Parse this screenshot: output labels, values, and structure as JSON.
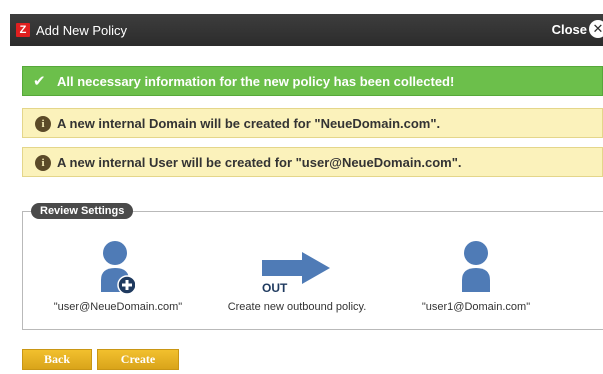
{
  "window": {
    "app_icon_glyph": "Z",
    "title": "Add New Policy",
    "close_label": "Close",
    "close_icon_glyph": "✕"
  },
  "banners": {
    "success": {
      "icon": "check-icon",
      "text": "All necessary information for the new policy has been collected!",
      "color": "#6cbf4b"
    },
    "domain_info": {
      "icon": "info-icon",
      "icon_glyph": "i",
      "text": "A new internal Domain will be created for \"NeueDomain.com\".",
      "color": "#fbf2bb"
    },
    "user_info": {
      "icon": "info-icon",
      "icon_glyph": "i",
      "text": "A new internal User will be created for \"user@NeueDomain.com\".",
      "color": "#fbf2bb"
    }
  },
  "review": {
    "legend": "Review Settings",
    "from": {
      "icon": "user-add-icon",
      "caption": "\"user@NeueDomain.com\""
    },
    "direction": {
      "icon": "arrow-right-icon",
      "label": "OUT",
      "caption": "Create new outbound policy."
    },
    "to": {
      "icon": "user-icon",
      "caption": "\"user1@Domain.com\""
    }
  },
  "buttons": {
    "back": "Back",
    "create": "Create"
  },
  "colors": {
    "titlebar": "#2c2c2c",
    "accent_blue": "#4f7bb6",
    "button": "#e0ad22"
  }
}
